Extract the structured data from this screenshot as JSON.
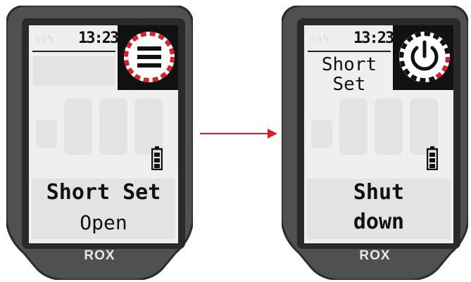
{
  "devices": [
    {
      "id": "before",
      "clock": "13:23",
      "status_icons": "☏▯ϟ",
      "primary_label": "Short Set",
      "secondary_label": "Open",
      "brand": "ROX",
      "button_icon": "hamburger-menu-icon"
    },
    {
      "id": "after",
      "clock": "13:23",
      "status_icons": "☏▯ϟ",
      "title_line1": "Short",
      "title_line2": "Set",
      "primary_label_line1": "Shut",
      "primary_label_line2": "down",
      "brand": "ROX",
      "button_icon": "power-icon"
    }
  ],
  "colors": {
    "accent_red": "#d8202a",
    "device_body": "#4a4a4a",
    "screen_bg": "#efefef"
  }
}
